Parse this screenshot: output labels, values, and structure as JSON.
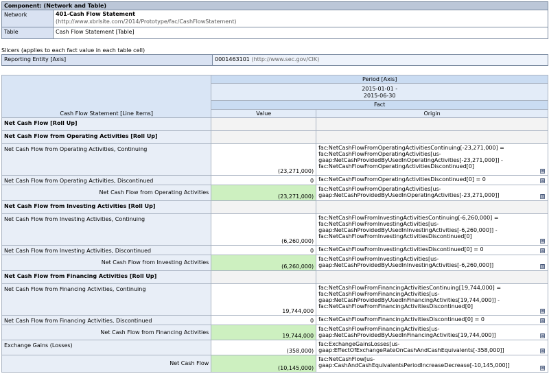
{
  "component": {
    "header": "Component: (Network and Table)",
    "network_label": "Network",
    "network_title": "401-Cash Flow Statement",
    "network_uri": "(http://www.xbrlsite.com/2014/Prototype/fac/CashFlowStatement)",
    "table_label": "Table",
    "table_value": "Cash Flow Statement [Table]"
  },
  "slicers": {
    "caption": "Slicers (applies to each fact value in each table cell)",
    "axis": "Reporting Entity [Axis]",
    "value": "0001463101",
    "value_uri": "(http://www.sec.gov/CIK)"
  },
  "main": {
    "period_axis": "Period [Axis]",
    "period_line1": "2015-01-01 -",
    "period_line2": "2015-06-30",
    "fact_header": "Fact",
    "line_items_header": "Cash Flow Statement [Line Items]",
    "value_header": "Value",
    "origin_header": "Origin",
    "expand_glyph": "⊞",
    "rows": [
      {
        "label": "Net Cash Flow [Roll Up]",
        "value": "",
        "origin": ""
      },
      {
        "label": "Net Cash Flow from Operating Activities [Roll Up]",
        "value": "",
        "origin": ""
      },
      {
        "label": "Net Cash Flow from Operating Activities, Continuing",
        "value": "(23,271,000)",
        "origin": "fac:NetCashFlowFromOperatingActivitiesContinuing[-23,271,000] = fac:NetCashFlowFromOperatingActivities[us-gaap:NetCashProvidedByUsedInOperatingActivities[-23,271,000]] - fac:NetCashFlowFromOperatingActivitiesDiscontinued[0]"
      },
      {
        "label": "Net Cash Flow from Operating Activities, Discontinued",
        "value": "0",
        "origin": "fac:NetCashFlowFromOperatingActivitiesDiscontinued[0] = 0"
      },
      {
        "label": "Net Cash Flow from Operating Activities",
        "value": "(23,271,000)",
        "origin": "fac:NetCashFlowFromOperatingActivities[us-gaap:NetCashProvidedByUsedInOperatingActivities[-23,271,000]]"
      },
      {
        "label": "Net Cash Flow from Investing Activities [Roll Up]",
        "value": "",
        "origin": ""
      },
      {
        "label": "Net Cash Flow from Investing Activities, Continuing",
        "value": "(6,260,000)",
        "origin": "fac:NetCashFlowFromInvestingActivitiesContinuing[-6,260,000] = fac:NetCashFlowFromInvestingActivities[us-gaap:NetCashProvidedByUsedInInvestingActivities[-6,260,000]] - fac:NetCashFlowFromInvestingActivitiesDiscontinued[0]"
      },
      {
        "label": "Net Cash Flow from Investing Activities, Discontinued",
        "value": "0",
        "origin": "fac:NetCashFlowFromInvestingActivitiesDiscontinued[0] = 0"
      },
      {
        "label": "Net Cash Flow from Investing Activities",
        "value": "(6,260,000)",
        "origin": "fac:NetCashFlowFromInvestingActivities[us-gaap:NetCashProvidedByUsedInInvestingActivities[-6,260,000]]"
      },
      {
        "label": "Net Cash Flow from Financing Activities [Roll Up]",
        "value": "",
        "origin": ""
      },
      {
        "label": "Net Cash Flow from Financing Activities, Continuing",
        "value": "19,744,000",
        "origin": "fac:NetCashFlowFromFinancingActivitiesContinuing[19,744,000] = fac:NetCashFlowFromFinancingActivities[us-gaap:NetCashProvidedByUsedInFinancingActivities[19,744,000]] - fac:NetCashFlowFromFinancingActivitiesDiscontinued[0]"
      },
      {
        "label": "Net Cash Flow from Financing Activities, Discontinued",
        "value": "0",
        "origin": "fac:NetCashFlowFromFinancingActivitiesDiscontinued[0] = 0"
      },
      {
        "label": "Net Cash Flow from Financing Activities",
        "value": "19,744,000",
        "origin": "fac:NetCashFlowFromFinancingActivities[us-gaap:NetCashProvidedByUsedInFinancingActivities[19,744,000]]"
      },
      {
        "label": "Exchange Gains (Losses)",
        "value": "(358,000)",
        "origin": "fac:ExchangeGainsLosses[us-gaap:EffectOfExchangeRateOnCashAndCashEquivalents[-358,000]]"
      },
      {
        "label": "Net Cash Flow",
        "value": "(10,145,000)",
        "origin": "fac:NetCashFlow[us-gaap:CashAndCashEquivalentsPeriodIncreaseDecrease[-10,145,000]]"
      }
    ]
  }
}
